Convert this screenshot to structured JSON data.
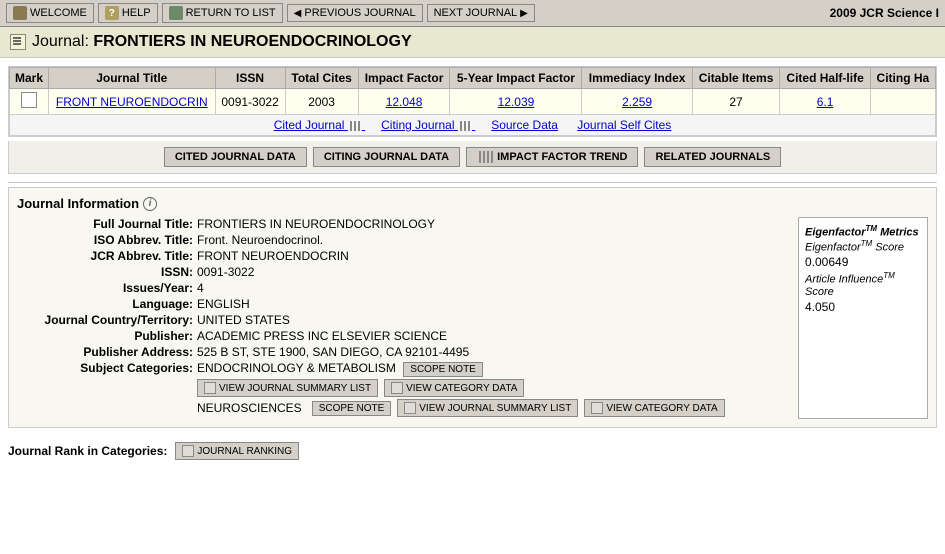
{
  "toolbar": {
    "app_title": "2009 JCR Science I",
    "buttons": [
      {
        "id": "welcome",
        "label": "WELCOME",
        "icon": "house-icon"
      },
      {
        "id": "help",
        "label": "HELP",
        "icon": "question-icon"
      },
      {
        "id": "return-to-list",
        "label": "RETURN TO LIST",
        "icon": "list-icon"
      },
      {
        "id": "previous-journal",
        "label": "PREVIOUS JOURNAL",
        "icon": "prev-icon"
      },
      {
        "id": "next-journal",
        "label": "NEXT JOURNAL",
        "icon": "next-icon"
      }
    ]
  },
  "page_title": {
    "prefix": "Journal:",
    "journal_name": "FRONTIERS IN NEUROENDOCRINOLOGY"
  },
  "table": {
    "headers": [
      "Mark",
      "Journal Title",
      "ISSN",
      "Total Cites",
      "Impact Factor",
      "5-Year Impact Factor",
      "Immediacy Index",
      "Citable Items",
      "Cited Half-life",
      "Citing Ha"
    ],
    "row": {
      "issn": "0091-3022",
      "total_cites": "2003",
      "impact_factor": "12.048",
      "five_year_impact": "12.039",
      "immediacy_index": "2.259",
      "citable_items": "27",
      "cited_half_life": "6.1",
      "journal_title": "FRONT NEUROENDOCRIN"
    }
  },
  "links_row": {
    "cited_journal": "Cited Journal",
    "citing_journal": "Citing Journal",
    "source_data": "Source Data",
    "journal_self_cites": "Journal Self Cites"
  },
  "action_buttons": {
    "cited_journal_data": "CITED JOURNAL DATA",
    "citing_journal_data": "CITING JOURNAL DATA",
    "impact_factor_trend": "IMPACT FACTOR TREND",
    "related_journals": "RELATED JOURNALS"
  },
  "journal_info": {
    "section_title": "Journal Information",
    "fields": {
      "full_title_label": "Full Journal Title:",
      "full_title_value": "FRONTIERS IN NEUROENDOCRINOLOGY",
      "iso_abbrev_label": "ISO Abbrev. Title:",
      "iso_abbrev_value": "Front. Neuroendocrinol.",
      "jcr_abbrev_label": "JCR Abbrev. Title:",
      "jcr_abbrev_value": "FRONT NEUROENDOCRIN",
      "issn_label": "ISSN:",
      "issn_value": "0091-3022",
      "issues_label": "Issues/Year:",
      "issues_value": "4",
      "language_label": "Language:",
      "language_value": "ENGLISH",
      "country_label": "Journal Country/Territory:",
      "country_value": "UNITED STATES",
      "publisher_label": "Publisher:",
      "publisher_value": "ACADEMIC PRESS INC ELSEVIER SCIENCE",
      "pub_address_label": "Publisher Address:",
      "pub_address_value": "525 B ST, STE 1900, SAN DIEGO, CA 92101-4495",
      "subject_label": "Subject Categories:",
      "subject_value1": "ENDOCRINOLOGY & METABOLISM",
      "subject_value2": "NEUROSCIENCES"
    },
    "scope_note": "SCOPE NOTE",
    "view_journal_summary": "VIEW JOURNAL SUMMARY LIST",
    "view_category_data": "VIEW CATEGORY DATA"
  },
  "eigenfactor": {
    "title": "Eigenfactor",
    "tm": "TM",
    "metrics": "Metrics",
    "score_label": "Eigenfactor",
    "score_tm": "TM",
    "score_sub": "Score",
    "score_value": "0.00649",
    "ai_label": "Article Influence",
    "ai_tm": "TM",
    "ai_sub": "Score",
    "ai_value": "4.050"
  },
  "journal_rank": {
    "label": "Journal Rank in Categories:",
    "button": "JOURNAL RANKING"
  }
}
